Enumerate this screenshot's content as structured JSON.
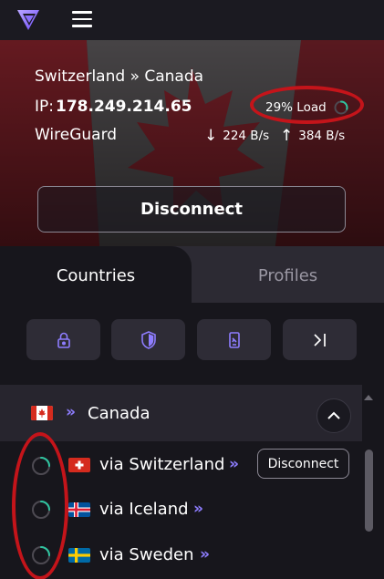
{
  "header": {
    "logo_icon": "vpn-triangle-logo-icon",
    "menu_icon": "hamburger-menu-icon"
  },
  "connection": {
    "route": "Switzerland » Canada",
    "ip_label": "IP:",
    "ip_value": "178.249.214.65",
    "load": "29% Load",
    "load_percent": 29,
    "protocol": "WireGuard",
    "download": "224 B/s",
    "upload": "384 B/s",
    "disconnect_label": "Disconnect"
  },
  "tabs": {
    "countries": "Countries",
    "profiles": "Profiles",
    "active": "Countries"
  },
  "filters": [
    {
      "icon": "secure-core-lock-icon"
    },
    {
      "icon": "shield-icon"
    },
    {
      "icon": "phone-tor-icon"
    },
    {
      "icon": "exit-arrow-icon"
    }
  ],
  "list": {
    "country": {
      "name": "Canada",
      "flag": "canada-flag-icon"
    },
    "servers": [
      {
        "label": "via Switzerland",
        "flag": "switzerland-flag-icon",
        "action": "Disconnect"
      },
      {
        "label": "via Iceland",
        "flag": "iceland-flag-icon"
      },
      {
        "label": "via Sweden",
        "flag": "sweden-flag-icon"
      }
    ]
  },
  "colors": {
    "accent": "#8e7dff",
    "annotation": "#c4141a",
    "load_ring": "#2fc4a0",
    "background": "#17161c"
  }
}
